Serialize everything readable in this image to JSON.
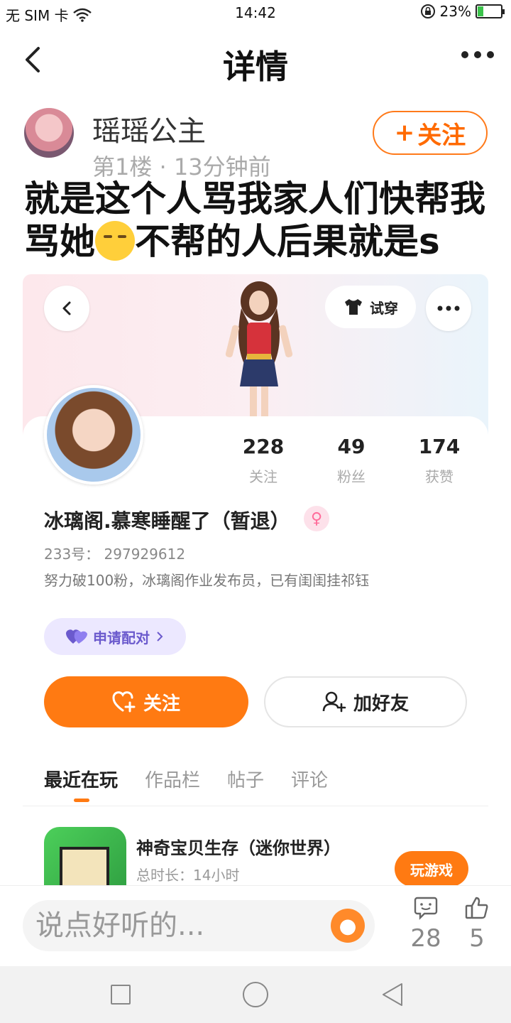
{
  "status_bar": {
    "carrier": "无 SIM 卡",
    "time": "14:42",
    "battery": "23%",
    "battery_level": 0.23
  },
  "header": {
    "title": "详情"
  },
  "post": {
    "author": "瑶瑶公主",
    "meta": "第1楼 · 13分钟前",
    "follow_label": "关注",
    "follow_plus": "+",
    "text_part1": "就是这个人骂我家人们快帮我骂她",
    "text_part2": "不帮的人后果就是s"
  },
  "profile_card": {
    "tryon_label": "试穿",
    "stats": [
      {
        "value": "228",
        "label": "关注"
      },
      {
        "value": "49",
        "label": "粉丝"
      },
      {
        "value": "174",
        "label": "获赞"
      }
    ],
    "name": "冰璃阁.慕寒睡醒了（暂退）",
    "gender_symbol": "♀",
    "id_text": "233号： 297929612",
    "bio": "努力破100粉，冰璃阁作业发布员，已有闺闺挂祁钰",
    "pair_label": "申请配对",
    "follow_label": "关注",
    "add_friend_label": "加好友",
    "tabs": [
      "最近在玩",
      "作品栏",
      "帖子",
      "评论"
    ],
    "game": {
      "name": "神奇宝贝生存（迷你世界）",
      "time": "总时长：14小时",
      "play_label": "玩游戏"
    }
  },
  "comment_bar": {
    "placeholder": "说点好听的...",
    "comment_count": "28",
    "like_count": "5"
  }
}
